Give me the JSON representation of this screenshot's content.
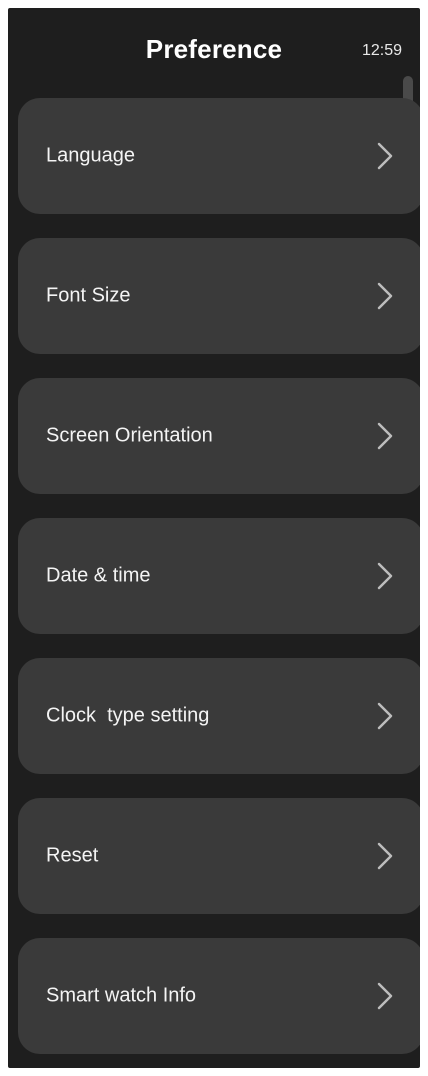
{
  "header": {
    "title": "Preference",
    "time": "12:59"
  },
  "menu": {
    "items": [
      {
        "label": "Language",
        "icon": "chevron-right-icon"
      },
      {
        "label": "Font Size",
        "icon": "chevron-right-icon"
      },
      {
        "label": "Screen Orientation",
        "icon": "chevron-right-icon"
      },
      {
        "label": "Date & time",
        "icon": "chevron-right-icon"
      },
      {
        "label": "Clock  type setting",
        "icon": "chevron-right-icon"
      },
      {
        "label": "Reset",
        "icon": "chevron-right-icon"
      },
      {
        "label": "Smart watch Info",
        "icon": "chevron-right-icon"
      }
    ]
  },
  "colors": {
    "background": "#1e1e1e",
    "card": "#3a3a3a",
    "text": "#f4f4f4",
    "chevron": "#bdbdbd"
  }
}
